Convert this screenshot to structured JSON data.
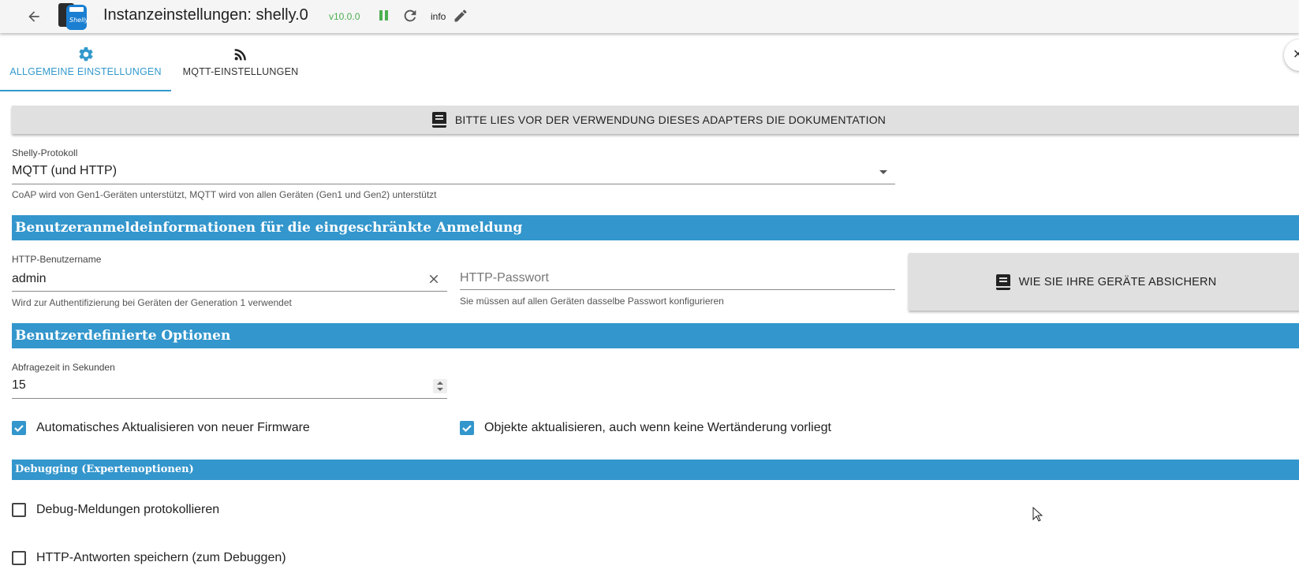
{
  "topbar": {
    "title": "Instanzeinstellungen: shelly.0",
    "version": "v10.0.0",
    "info": "info",
    "icons": [
      "arrow-left-icon",
      "shelly-logo",
      "pause-icon",
      "reload-icon",
      "pencil-icon"
    ],
    "colors": {
      "version": "#4caf50",
      "pause": "#4caf50"
    }
  },
  "tabs": [
    {
      "label": "ALLGEMEINE EINSTELLUNGEN",
      "icon": "gear-icon",
      "active": true
    },
    {
      "label": "MQTT-EINSTELLUNGEN",
      "icon": "rss-icon",
      "active": false
    }
  ],
  "doc_button": {
    "label": "BITTE LIES VOR DER VERWENDUNG DIESES ADAPTERS DIE DOKUMENTATION",
    "icon": "book-icon"
  },
  "protocol": {
    "label": "Shelly-Protokoll",
    "value": "MQTT (und HTTP)",
    "helper": "CoAP wird von Gen1-Geräten unterstützt, MQTT wird von allen Geräten (Gen1 und Gen2) unterstützt"
  },
  "section_credentials": {
    "title": "Benutzeranmeldeinformationen für die eingeschränkte Anmeldung"
  },
  "username": {
    "label": "HTTP-Benutzername",
    "value": "admin",
    "helper": "Wird zur Authentifizierung bei Geräten der Generation 1 verwendet"
  },
  "password": {
    "placeholder": "HTTP-Passwort",
    "helper": "Sie müssen auf allen Geräten dasselbe Passwort konfigurieren"
  },
  "secure_button": {
    "label": "WIE SIE IHRE GERÄTE ABSICHERN",
    "icon": "book-icon"
  },
  "section_custom": {
    "title": "Benutzerdefinierte Optionen"
  },
  "polling": {
    "label": "Abfragezeit in Sekunden",
    "value": "15"
  },
  "checkboxes": {
    "firmware": {
      "label": "Automatisches Aktualisieren von neuer Firmware",
      "checked": true
    },
    "update_objects": {
      "label": "Objekte aktualisieren, auch wenn keine Wertänderung vorliegt",
      "checked": true
    }
  },
  "section_debug": {
    "title": "Debugging (Expertenoptionen)"
  },
  "debug_checkboxes": {
    "log_debug": {
      "label": "Debug-Meldungen protokollieren",
      "checked": false
    },
    "save_http": {
      "label": "HTTP-Antworten speichern (zum Debuggen)",
      "checked": false
    }
  },
  "colors": {
    "accent": "#3396cc",
    "button_bg": "#e0e0e0"
  }
}
